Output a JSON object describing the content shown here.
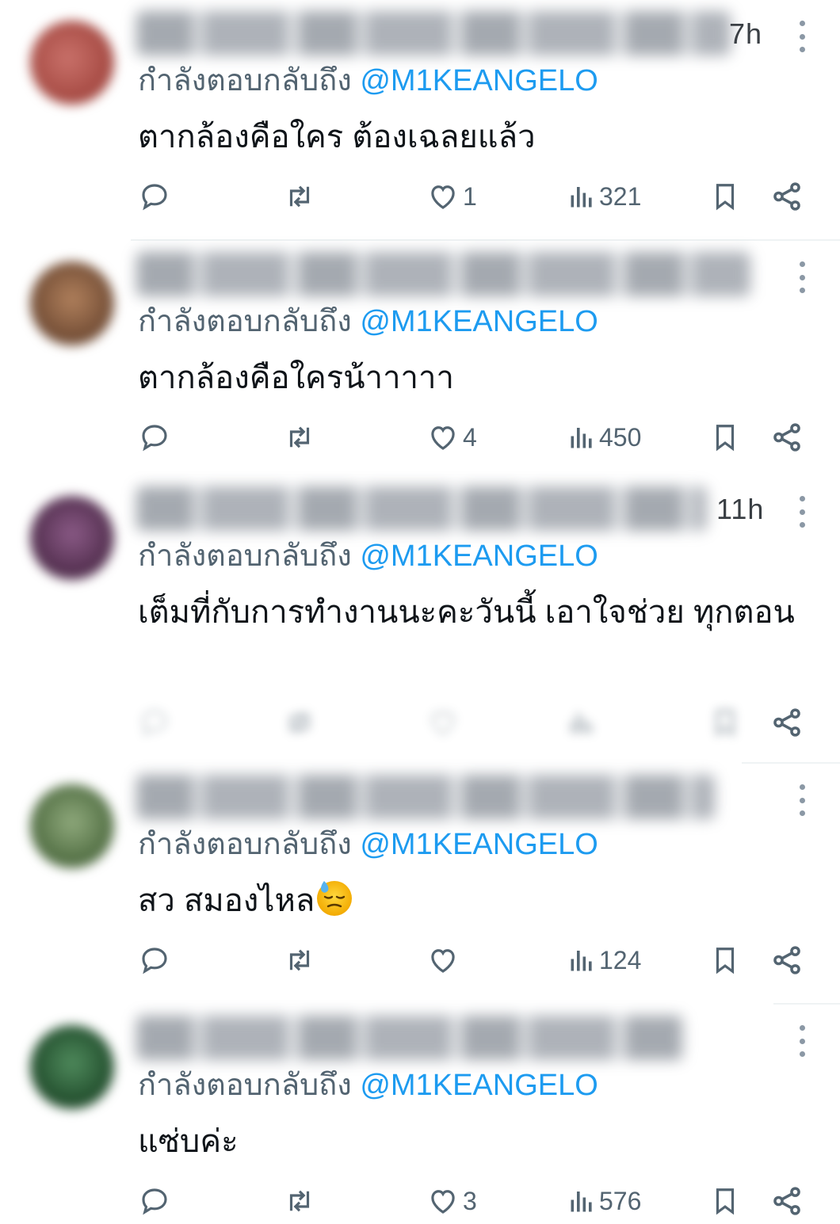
{
  "colors": {
    "accent": "#1d9bf0",
    "muted": "#536471",
    "text": "#0f1419"
  },
  "replies": [
    {
      "timestamp": "7h",
      "reply_prefix": "กำลังตอบกลับถึง",
      "mention": "@M1KEANGELO",
      "text": "ตากล้องคือใคร ต้องเฉลยแล้ว",
      "likes": "1",
      "views": "321",
      "avatar_color": "#b3554e"
    },
    {
      "timestamp": "",
      "reply_prefix": "กำลังตอบกลับถึง",
      "mention": "@M1KEANGELO",
      "text": "ตากล้องคือใครน้าาาาา",
      "likes": "4",
      "views": "450",
      "avatar_color": "#8c5a3f"
    },
    {
      "timestamp": "11h",
      "reply_prefix": "กำลังตอบกลับถึง",
      "mention": "@M1KEANGELO",
      "text": "เต็มที่กับการทำงานนะคะวันนี้ เอาใจช่วย ทุกตอน",
      "likes": "",
      "views": "",
      "avatar_color": "#6e3f6a"
    },
    {
      "timestamp": "",
      "reply_prefix": "กำลังตอบกลับถึง",
      "mention": "@M1KEANGELO",
      "text": "สว สมองไหล",
      "likes": "",
      "views": "124",
      "avatar_color": "#5d7a4e",
      "emoji": "downcast-face-with-sweat"
    },
    {
      "timestamp": "",
      "reply_prefix": "กำลังตอบกลับถึง",
      "mention": "@M1KEANGELO",
      "text": "แซ่บค่ะ",
      "likes": "3",
      "views": "576",
      "avatar_color": "#2f5e3a"
    }
  ]
}
